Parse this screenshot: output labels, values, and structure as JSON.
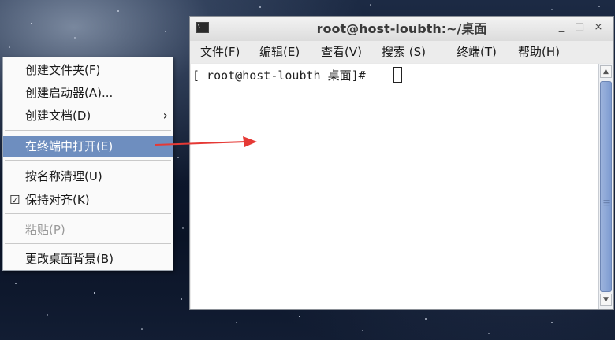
{
  "context_menu": {
    "items": [
      {
        "label": "创建文件夹(F)"
      },
      {
        "label": "创建启动器(A)..."
      },
      {
        "label": "创建文档(D)"
      },
      {
        "label": "在终端中打开(E)"
      },
      {
        "label": "按名称清理(U)"
      },
      {
        "label": "保持对齐(K)"
      },
      {
        "label": "粘贴(P)"
      },
      {
        "label": "更改桌面背景(B)"
      }
    ],
    "submenu_glyph": "›",
    "check_glyph": "☑"
  },
  "terminal": {
    "title": "root@host-loubth:~/桌面",
    "controls": {
      "minimize": "_",
      "maximize": "□",
      "close": "×"
    },
    "menu": [
      "文件(F)",
      "编辑(E)",
      "查看(V)",
      "搜索 (S)",
      "终端(T)",
      "帮助(H)"
    ],
    "prompt": "[ root@host-loubth 桌面]#"
  },
  "colors": {
    "menu_highlight": "#6e8ebf",
    "arrow": "#e53935"
  },
  "icons": {
    "terminal_icon": "terminal-icon",
    "submenu": "chevron-right-icon",
    "check": "checkbox-checked-icon",
    "annotation": "red-arrow"
  }
}
